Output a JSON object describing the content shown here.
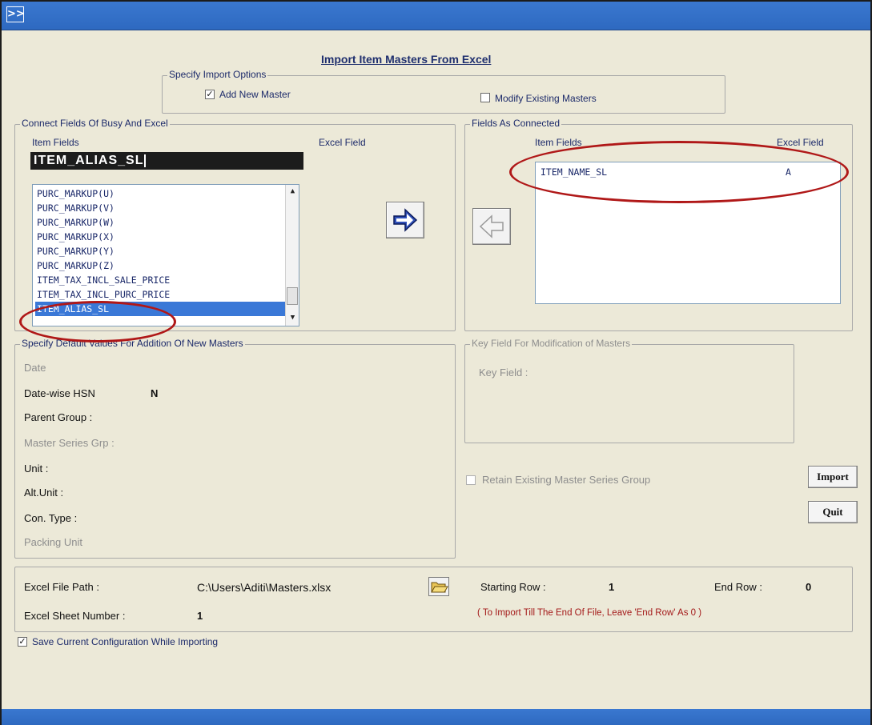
{
  "window": {
    "expand_glyph": ">>"
  },
  "dialog": {
    "title": "Import Item Masters From Excel"
  },
  "import_options": {
    "legend": "Specify Import Options",
    "add_new_master": {
      "label": "Add New Master",
      "checked": true
    },
    "modify_existing": {
      "label": "Modify Existing Masters",
      "checked": false
    }
  },
  "connect_fields": {
    "legend": "Connect Fields Of Busy And Excel",
    "item_fields_header": "Item Fields",
    "excel_field_header": "Excel Field",
    "selected_field_value": "ITEM_ALIAS_SL",
    "list_items": [
      "PURC_MARKUP(U)",
      "PURC_MARKUP(V)",
      "PURC_MARKUP(W)",
      "PURC_MARKUP(X)",
      "PURC_MARKUP(Y)",
      "PURC_MARKUP(Z)",
      "ITEM_TAX_INCL_SALE_PRICE",
      "ITEM_TAX_INCL_PURC_PRICE",
      "ITEM_ALIAS_SL"
    ],
    "selected_index": 8
  },
  "fields_connected": {
    "legend": "Fields As Connected",
    "item_fields_header": "Item Fields",
    "excel_field_header": "Excel Field",
    "rows": [
      {
        "item_field": "ITEM_NAME_SL",
        "excel_field": "A"
      }
    ]
  },
  "defaults": {
    "legend": "Specify Default Values For Addition Of New Masters",
    "date_label": "Date",
    "datewise_hsn_label": "Date-wise HSN",
    "datewise_hsn_value": "N",
    "parent_group_label": "Parent Group :",
    "master_series_label": "Master Series Grp :",
    "unit_label": "Unit :",
    "alt_unit_label": "Alt.Unit :",
    "con_type_label": "Con. Type :",
    "packing_unit_label": "Packing Unit"
  },
  "key_field": {
    "legend": "Key Field For Modification of Masters",
    "label": "Key Field :"
  },
  "retain_series": {
    "label": "Retain Existing Master Series Group",
    "checked": false
  },
  "buttons": {
    "import": "Import",
    "quit": "Quit"
  },
  "file": {
    "path_label": "Excel File Path :",
    "path_value": "C:\\Users\\Aditi\\Masters.xlsx",
    "sheet_label": "Excel Sheet Number :",
    "sheet_value": "1",
    "starting_row_label": "Starting Row :",
    "starting_row_value": "1",
    "end_row_label": "End Row :",
    "end_row_value": "0",
    "hint": "( To Import Till The End Of File, Leave  'End Row' As 0 )"
  },
  "save_config": {
    "label": "Save Current Configuration While Importing",
    "checked": true
  },
  "colors": {
    "title_bar": "#3a78d0",
    "dialog_bg": "#ece9d8",
    "selection": "#3a78d7",
    "annotation": "#b01818"
  }
}
